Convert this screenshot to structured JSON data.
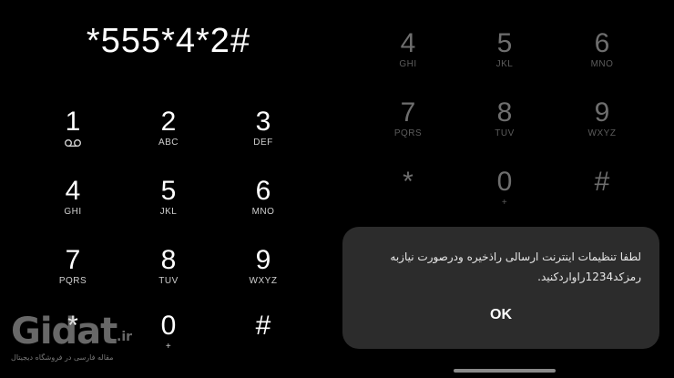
{
  "dialer": {
    "display": "*555*4*2#",
    "keys": [
      {
        "num": "1",
        "letters": ""
      },
      {
        "num": "2",
        "letters": "ABC"
      },
      {
        "num": "3",
        "letters": "DEF"
      },
      {
        "num": "4",
        "letters": "GHI"
      },
      {
        "num": "5",
        "letters": "JKL"
      },
      {
        "num": "6",
        "letters": "MNO"
      },
      {
        "num": "7",
        "letters": "PQRS"
      },
      {
        "num": "8",
        "letters": "TUV"
      },
      {
        "num": "9",
        "letters": "WXYZ"
      },
      {
        "num": "*",
        "letters": ""
      },
      {
        "num": "0",
        "letters": "+"
      },
      {
        "num": "#",
        "letters": ""
      }
    ]
  },
  "alert": {
    "message": "لطفا تنظیمات اینترنت ارسالی راذخیره ودرصورت نیازبه رمزکد1234راواردکنید.",
    "ok_label": "OK"
  },
  "watermark": {
    "logo": "Gidat",
    "suffix": ".ir",
    "tagline": "مقاله فارسی در فروشگاه دیجیتال"
  },
  "colors": {
    "background": "#000000",
    "alert_background": "#2c2c2c",
    "dimmed_key": "#6e6e6e"
  }
}
